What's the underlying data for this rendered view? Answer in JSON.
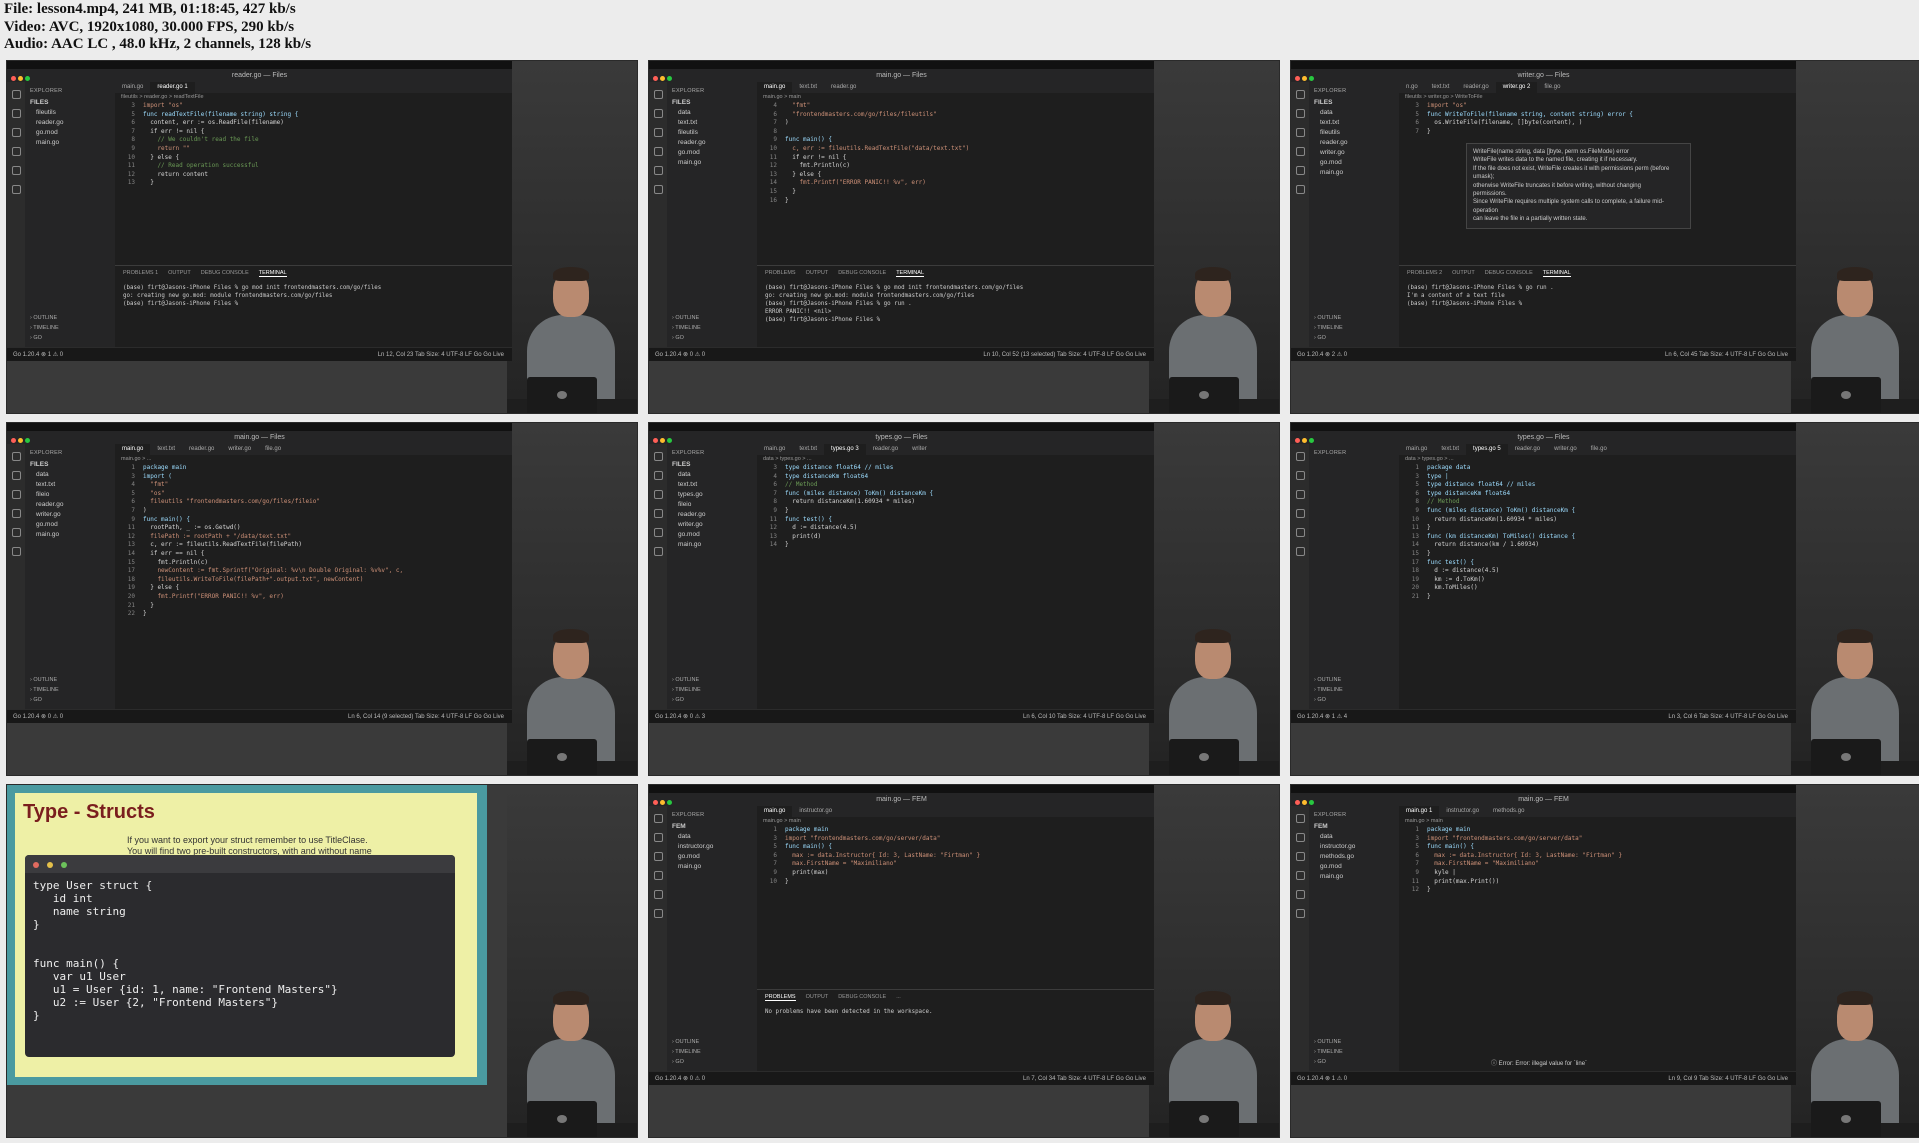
{
  "header": {
    "file": "File: lesson4.mp4, 241 MB, 01:18:45, 427 kb/s",
    "video": "Video: AVC, 1920x1080, 30.000 FPS, 290 kb/s",
    "audio": "Audio: AAC LC , 48.0 kHz, 2 channels, 128 kb/s"
  },
  "colors": {
    "editor_bg": "#1e1e1e",
    "slide_bg": "#eef0a6",
    "slide_frame": "#4a9aa0",
    "title_red": "#7a1e1e"
  },
  "frames": [
    {
      "title": "reader.go — Files",
      "tabs": [
        "main.go",
        "reader.go 1"
      ],
      "crumb": "fileutils > reader.go > readTextFile",
      "explorer": [
        "FILES",
        "fileutils",
        "reader.go",
        "go.mod",
        "main.go"
      ],
      "code": [
        {
          "n": "3",
          "t": "import \"os\""
        },
        {
          "n": "5",
          "t": "func readTextFile(filename string) string {"
        },
        {
          "n": "6",
          "t": "  content, err := os.ReadFile(filename)"
        },
        {
          "n": "7",
          "t": "  if err != nil {"
        },
        {
          "n": "8",
          "t": "    // We couldn't read the file"
        },
        {
          "n": "9",
          "t": "    return \"\""
        },
        {
          "n": "10",
          "t": "  } else {"
        },
        {
          "n": "11",
          "t": "    // Read operation successful"
        },
        {
          "n": "12",
          "t": "    return content"
        },
        {
          "n": "13",
          "t": "  }"
        }
      ],
      "panel_tabs": [
        "PROBLEMS 1",
        "OUTPUT",
        "DEBUG CONSOLE",
        "TERMINAL"
      ],
      "terminal": "(base) firt@Jasons-iPhone Files % go mod init frontendmasters.com/go/files\ngo: creating new go.mod: module frontendmasters.com/go/files\n(base) firt@Jasons-iPhone Files %",
      "status_left": "Go 1.20.4   ⊗ 1 ⚠ 0",
      "status_right": "Ln 12, Col 23  Tab Size: 4  UTF-8  LF  Go  Go Live"
    },
    {
      "title": "main.go — Files",
      "tabs": [
        "main.go",
        "text.txt",
        "reader.go"
      ],
      "crumb": "main.go > main",
      "explorer": [
        "FILES",
        "data",
        "text.txt",
        "fileutils",
        "reader.go",
        "go.mod",
        "main.go"
      ],
      "code": [
        {
          "n": "4",
          "t": "  \"fmt\""
        },
        {
          "n": "6",
          "t": "  \"frontendmasters.com/go/files/fileutils\""
        },
        {
          "n": "7",
          "t": ")"
        },
        {
          "n": "8",
          "t": ""
        },
        {
          "n": "9",
          "t": "func main() {"
        },
        {
          "n": "10",
          "t": "  c, err := fileutils.ReadTextFile(\"data/text.txt\")"
        },
        {
          "n": "11",
          "t": "  if err != nil {"
        },
        {
          "n": "12",
          "t": "    fmt.Println(c)"
        },
        {
          "n": "13",
          "t": "  } else {"
        },
        {
          "n": "14",
          "t": "    fmt.Printf(\"ERROR PANIC!! %v\", err)"
        },
        {
          "n": "15",
          "t": "  }"
        },
        {
          "n": "16",
          "t": "}"
        }
      ],
      "panel_tabs": [
        "PROBLEMS",
        "OUTPUT",
        "DEBUG CONSOLE",
        "TERMINAL"
      ],
      "terminal": "(base) firt@Jasons-iPhone Files % go mod init frontendmasters.com/go/files\ngo: creating new go.mod: module frontendmasters.com/go/files\n(base) firt@Jasons-iPhone Files % go run .\nERROR PANIC!! <nil>\n(base) firt@Jasons-iPhone Files %",
      "status_left": "Go 1.20.4   ⊗ 0 ⚠ 0",
      "status_right": "Ln 10, Col 52 (13 selected)  Tab Size: 4  UTF-8  LF  Go  Go Live"
    },
    {
      "title": "writer.go — Files",
      "tabs": [
        "n.go",
        "text.txt",
        "reader.go",
        "writer.go 2",
        "file.go"
      ],
      "crumb": "fileutils > writer.go > WriteToFile",
      "explorer": [
        "FILES",
        "data",
        "text.txt",
        "fileutils",
        "reader.go",
        "writer.go",
        "go.mod",
        "main.go"
      ],
      "code": [
        {
          "n": "3",
          "t": "import \"os\""
        },
        {
          "n": "5",
          "t": "func WriteToFile(filename string, content string) error {"
        },
        {
          "n": "6",
          "t": "  os.WriteFile(filename, []byte(content), )"
        },
        {
          "n": "7",
          "t": "}"
        }
      ],
      "tooltip": "WriteFile(name string, data []byte, perm os.FileMode) error\nWriteFile writes data to the named file, creating it if necessary.\nIf the file does not exist, WriteFile creates it with permissions perm (before\numask);\notherwise WriteFile truncates it before writing, without changing\npermissions.\nSince WriteFile requires multiple system calls to complete, a failure mid-\noperation\ncan leave the file in a partially written state.",
      "panel_tabs": [
        "PROBLEMS 2",
        "OUTPUT",
        "DEBUG CONSOLE",
        "TERMINAL"
      ],
      "terminal": "(base) firt@Jasons-iPhone Files % go run .\nI'm a content of a text file\n(base) firt@Jasons-iPhone Files %",
      "status_left": "Go 1.20.4   ⊗ 2 ⚠ 0",
      "status_right": "Ln 6, Col 45  Tab Size: 4  UTF-8  LF  Go  Go Live"
    },
    {
      "title": "main.go — Files",
      "tabs": [
        "main.go",
        "text.txt",
        "reader.go",
        "writer.go",
        "file.go"
      ],
      "crumb": "main.go > ...",
      "explorer": [
        "FILES",
        "data",
        "text.txt",
        "fileio",
        "reader.go",
        "writer.go",
        "go.mod",
        "main.go"
      ],
      "code": [
        {
          "n": "1",
          "t": "package main"
        },
        {
          "n": "3",
          "t": "import ("
        },
        {
          "n": "4",
          "t": "  \"fmt\""
        },
        {
          "n": "5",
          "t": "  \"os\""
        },
        {
          "n": "6",
          "t": "  fileutils \"frontendmasters.com/go/files/fileio\""
        },
        {
          "n": "7",
          "t": ")"
        },
        {
          "n": "9",
          "t": "func main() {"
        },
        {
          "n": "11",
          "t": "  rootPath, _ := os.Getwd()"
        },
        {
          "n": "12",
          "t": "  filePath := rootPath + \"/data/text.txt\""
        },
        {
          "n": "13",
          "t": "  c, err := fileutils.ReadTextFile(filePath)"
        },
        {
          "n": "14",
          "t": "  if err == nil {"
        },
        {
          "n": "15",
          "t": "    fmt.Println(c)"
        },
        {
          "n": "17",
          "t": "    newContent := fmt.Sprintf(\"Original: %v\\n Double Original: %v%v\", c,"
        },
        {
          "n": "18",
          "t": "    fileutils.WriteToFile(filePath+\".output.txt\", newContent)"
        },
        {
          "n": "19",
          "t": "  } else {"
        },
        {
          "n": "20",
          "t": "    fmt.Printf(\"ERROR PANIC!! %v\", err)"
        },
        {
          "n": "21",
          "t": "  }"
        },
        {
          "n": "22",
          "t": "}"
        }
      ],
      "status_left": "Go 1.20.4   ⊗ 0 ⚠ 0",
      "status_right": "Ln 6, Col 14 (9 selected)  Tab Size: 4  UTF-8  LF  Go  Go Live"
    },
    {
      "title": "types.go — Files",
      "tabs": [
        "main.go",
        "text.txt",
        "types.go 3",
        "reader.go",
        "writer"
      ],
      "crumb": "data > types.go > ...",
      "explorer": [
        "FILES",
        "data",
        "text.txt",
        "types.go",
        "fileio",
        "reader.go",
        "writer.go",
        "go.mod",
        "main.go"
      ],
      "code": [
        {
          "n": "3",
          "t": "type distance float64 // miles"
        },
        {
          "n": "4",
          "t": "type distanceKm float64"
        },
        {
          "n": "6",
          "t": "// Method"
        },
        {
          "n": "7",
          "t": "func (miles distance) ToKm() distanceKm {"
        },
        {
          "n": "8",
          "t": "  return distanceKm(1.60934 * miles)"
        },
        {
          "n": "9",
          "t": "}"
        },
        {
          "n": "11",
          "t": "func test() {"
        },
        {
          "n": "12",
          "t": "  d := distance(4.5)"
        },
        {
          "n": "13",
          "t": "  print(d)"
        },
        {
          "n": "14",
          "t": "}"
        }
      ],
      "status_left": "Go 1.20.4   ⊗ 0 ⚠ 3",
      "status_right": "Ln 6, Col 10  Tab Size: 4  UTF-8  LF  Go  Go Live"
    },
    {
      "title": "types.go — Files",
      "tabs": [
        "main.go",
        "text.txt",
        "types.go 5",
        "reader.go",
        "writer.go",
        "file.go"
      ],
      "crumb": "data > types.go > ...",
      "explorer": [],
      "code": [
        {
          "n": "1",
          "t": "package data"
        },
        {
          "n": "3",
          "t": "type |"
        },
        {
          "n": "5",
          "t": "type distance float64 // miles"
        },
        {
          "n": "6",
          "t": "type distanceKm float64"
        },
        {
          "n": "8",
          "t": "// Method"
        },
        {
          "n": "9",
          "t": "func (miles distance) ToKm() distanceKm {"
        },
        {
          "n": "10",
          "t": "  return distanceKm(1.60934 * miles)"
        },
        {
          "n": "11",
          "t": "}"
        },
        {
          "n": "13",
          "t": "func (km distanceKm) ToMiles() distance {"
        },
        {
          "n": "14",
          "t": "  return distance(km / 1.60934)"
        },
        {
          "n": "15",
          "t": "}"
        },
        {
          "n": "17",
          "t": "func test() {"
        },
        {
          "n": "18",
          "t": "  d := distance(4.5)"
        },
        {
          "n": "19",
          "t": "  km := d.ToKm()"
        },
        {
          "n": "20",
          "t": "  km.ToMiles()"
        },
        {
          "n": "21",
          "t": "}"
        }
      ],
      "status_left": "Go 1.20.4   ⊗ 1 ⚠ 4",
      "status_right": "Ln 3, Col 6  Tab Size: 4  UTF-8  LF  Go  Go Live"
    },
    {
      "slide": true,
      "title": "Type - Structs",
      "note": "If you want to export your struct remember to use TitleClase.\nYou will find two pre-built constructors, with and without name",
      "code": "type User struct {\n   id int\n   name string\n}\n\n\nfunc main() {\n   var u1 User\n   u1 = User {id: 1, name: \"Frontend Masters\"}\n   u2 := User {2, \"Frontend Masters\"}\n}"
    },
    {
      "title": "main.go — FEM",
      "tabs": [
        "main.go",
        "instructor.go"
      ],
      "crumb": "main.go > main",
      "explorer": [
        "FEM",
        "data",
        "instructor.go",
        "go.mod",
        "main.go"
      ],
      "code": [
        {
          "n": "1",
          "t": "package main"
        },
        {
          "n": "3",
          "t": "import \"frontendmasters.com/go/server/data\""
        },
        {
          "n": "5",
          "t": "func main() {"
        },
        {
          "n": "6",
          "t": "  max := data.Instructor{ Id: 3, LastName: \"Firtman\" }"
        },
        {
          "n": "7",
          "t": "  max.FirstName = \"Maximiliano\""
        },
        {
          "n": "9",
          "t": "  print(max)"
        },
        {
          "n": "10",
          "t": "}"
        }
      ],
      "panel_tabs": [
        "PROBLEMS",
        "OUTPUT",
        "DEBUG CONSOLE",
        "..."
      ],
      "terminal": "No problems have been detected in the workspace.",
      "status_left": "Go 1.20.4   ⊗ 0 ⚠ 0",
      "status_right": "Ln 7, Col 34  Tab Size: 4  UTF-8  LF  Go  Go Live"
    },
    {
      "title": "main.go — FEM",
      "tabs": [
        "main.go 1",
        "instructor.go",
        "methods.go"
      ],
      "crumb": "main.go > main",
      "explorer": [
        "FEM",
        "data",
        "instructor.go",
        "methods.go",
        "go.mod",
        "main.go"
      ],
      "code": [
        {
          "n": "1",
          "t": "package main"
        },
        {
          "n": "3",
          "t": "import \"frontendmasters.com/go/server/data\""
        },
        {
          "n": "5",
          "t": "func main() {"
        },
        {
          "n": "6",
          "t": "  max := data.Instructor{ Id: 3, LastName: \"Firtman\" }"
        },
        {
          "n": "7",
          "t": "  max.FirstName = \"Maximiliano\""
        },
        {
          "n": "9",
          "t": "  kyle |"
        },
        {
          "n": "11",
          "t": "  print(max.Print())"
        },
        {
          "n": "12",
          "t": "}"
        }
      ],
      "error": "Error: Error: illegal value for `line`",
      "status_left": "Go 1.20.4   ⊗ 1 ⚠ 0",
      "status_right": "Ln 9, Col 9  Tab Size: 4  UTF-8  LF  Go  Go Live"
    }
  ]
}
